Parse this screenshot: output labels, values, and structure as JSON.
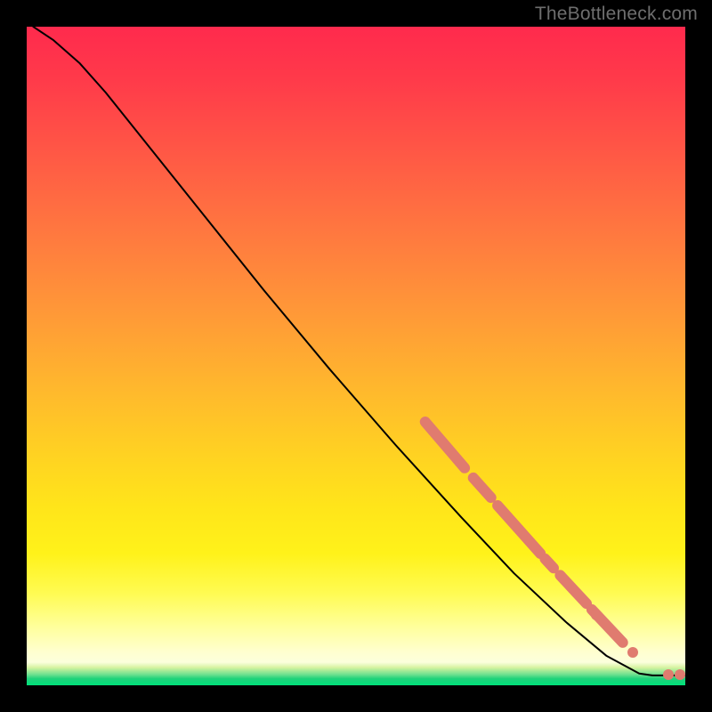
{
  "watermark": "TheBottleneck.com",
  "colors": {
    "marker": "#e07b6f",
    "curve": "#000000"
  },
  "chart_data": {
    "type": "line",
    "title": "",
    "xlabel": "",
    "ylabel": "",
    "axes_visible": false,
    "grid": false,
    "legend": false,
    "background": "rainbow-vertical (red→yellow→green)",
    "x_range_pct": [
      0,
      100
    ],
    "y_range_pct": [
      0,
      100
    ],
    "curve_pct": [
      [
        1.0,
        100.0
      ],
      [
        4.0,
        98.0
      ],
      [
        8.0,
        94.5
      ],
      [
        12.0,
        90.0
      ],
      [
        18.0,
        82.5
      ],
      [
        26.0,
        72.5
      ],
      [
        36.0,
        60.0
      ],
      [
        46.0,
        48.0
      ],
      [
        56.0,
        36.5
      ],
      [
        66.0,
        25.5
      ],
      [
        74.0,
        17.0
      ],
      [
        82.0,
        9.5
      ],
      [
        88.0,
        4.5
      ],
      [
        93.0,
        1.8
      ],
      [
        95.0,
        1.5
      ],
      [
        100.0,
        1.5
      ]
    ],
    "marker_segments_pct": [
      [
        [
          60.5,
          40.0
        ],
        [
          66.5,
          33.0
        ]
      ],
      [
        [
          67.8,
          31.5
        ],
        [
          70.5,
          28.5
        ]
      ],
      [
        [
          71.5,
          27.3
        ],
        [
          78.0,
          20.0
        ]
      ],
      [
        [
          78.7,
          19.2
        ],
        [
          80.0,
          17.8
        ]
      ],
      [
        [
          81.0,
          16.7
        ],
        [
          85.0,
          12.4
        ]
      ],
      [
        [
          85.8,
          11.5
        ],
        [
          90.5,
          6.5
        ]
      ]
    ],
    "marker_dots_pct": [
      [
        86.5,
        10.7
      ],
      [
        92.0,
        5.0
      ],
      [
        97.4,
        1.6
      ],
      [
        99.2,
        1.6
      ]
    ],
    "marker_thickness_px": 12,
    "marker_dot_diameter_px": 12
  }
}
